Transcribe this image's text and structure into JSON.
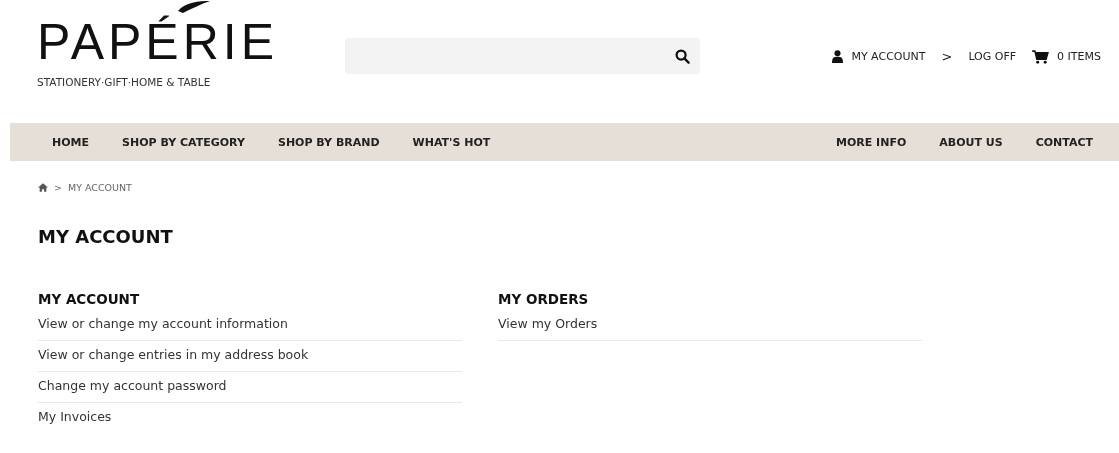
{
  "logo": {
    "name": "PAPÉRIE",
    "tagline": "STATIONERY·GIFT·HOME & TABLE"
  },
  "account_links": [
    {
      "kind": "account",
      "label": "MY ACCOUNT"
    },
    {
      "kind": "separator",
      "label": ">"
    },
    {
      "kind": "logoff",
      "label": "LOG OFF"
    },
    {
      "kind": "cart",
      "label": "0 ITEMS"
    }
  ],
  "nav_left": [
    "HOME",
    "SHOP BY CATEGORY",
    "SHOP BY BRAND",
    "WHAT'S HOT"
  ],
  "nav_right": [
    "MORE INFO",
    "ABOUT US",
    "CONTACT"
  ],
  "breadcrumb": {
    "separator": ">",
    "current": "MY ACCOUNT"
  },
  "title": "MY ACCOUNT",
  "sections": [
    {
      "heading": "MY ACCOUNT",
      "links": [
        "View or change my account information",
        "View or change entries in my address book",
        "Change my account password",
        "My Invoices"
      ]
    },
    {
      "heading": "MY ORDERS",
      "links": [
        "View my Orders"
      ]
    }
  ]
}
